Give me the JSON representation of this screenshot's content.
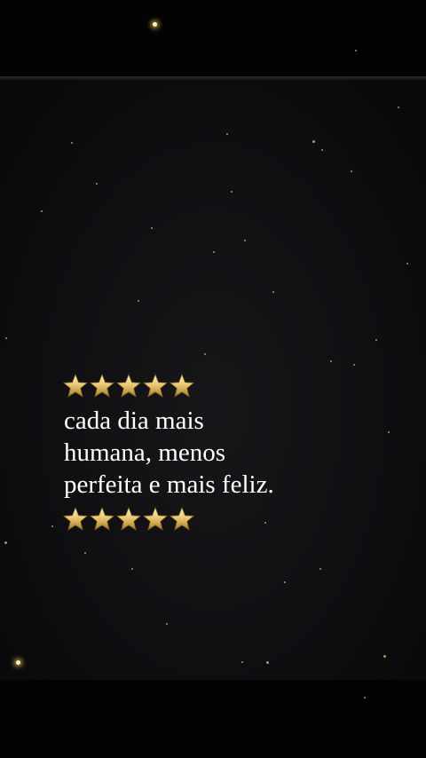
{
  "quote": {
    "lines": [
      "cada dia mais",
      "humana, menos",
      "perfeita e mais feliz."
    ]
  },
  "decoration": {
    "star_emoji_count_top": 5,
    "star_emoji_count_bottom": 5,
    "star_icon": "gold-star-icon",
    "background": "night-sky-with-stars"
  },
  "colors": {
    "background": "#000000",
    "photo_tint": "#111114",
    "text": "#ffffff",
    "star_gold": "#d9b45a"
  }
}
